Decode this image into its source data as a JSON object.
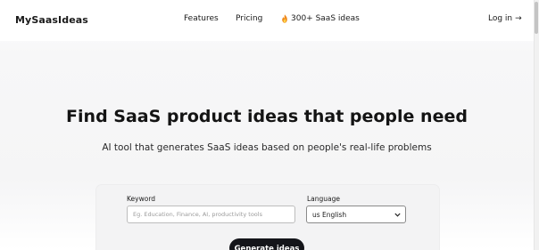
{
  "header": {
    "logo": "MySaasIdeas",
    "nav": {
      "features": "Features",
      "pricing": "Pricing",
      "ideas": "300+ SaaS ideas",
      "ideas_icon": "fire-icon",
      "login": "Log in",
      "login_icon": "arrow-right-icon"
    }
  },
  "hero": {
    "title": "Find SaaS product ideas that people need",
    "subtitle": "AI tool that generates SaaS ideas based on people's real-life problems"
  },
  "form": {
    "keyword_label": "Keyword",
    "keyword_placeholder": "Eg. Education, Finance, AI, productivity tools",
    "keyword_value": "",
    "language_label": "Language",
    "language_value": "us English",
    "submit_label": "Generate ideas"
  },
  "colors": {
    "accent_button": "#14151a",
    "text": "#1a1a1a",
    "fire": "#f5a623"
  }
}
